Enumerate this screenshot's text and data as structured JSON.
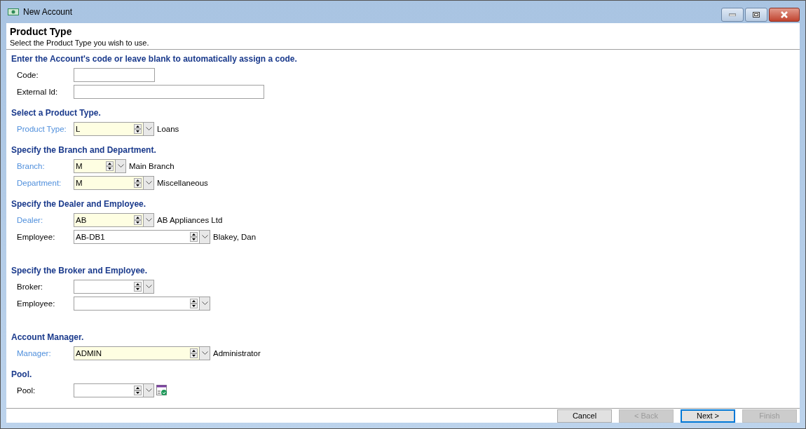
{
  "window": {
    "title": "New Account"
  },
  "header": {
    "title": "Product Type",
    "subtitle": "Select the Product Type you wish to use."
  },
  "sections": [
    {
      "heading": "Enter the Account's code or leave blank to automatically assign a code.",
      "fields": [
        {
          "label": "Code:",
          "kind": "short",
          "required": false
        },
        {
          "label": "External Id:",
          "kind": "long",
          "required": false
        }
      ]
    },
    {
      "heading": "Select a Product Type.",
      "fields": [
        {
          "label": "Product Type:",
          "kind": "combo",
          "required": true,
          "value": "L",
          "description": "Loans"
        }
      ]
    },
    {
      "heading": "Specify the Branch and Department.",
      "fields": [
        {
          "label": "Branch:",
          "kind": "combo-narrow",
          "required": true,
          "value": "M",
          "description": "Main Branch"
        },
        {
          "label": "Department:",
          "kind": "combo",
          "required": true,
          "value": "M",
          "description": "Miscellaneous"
        }
      ]
    },
    {
      "heading": "Specify the Dealer and Employee.",
      "fields": [
        {
          "label": "Dealer:",
          "kind": "combo",
          "required": true,
          "value": "AB",
          "description": "AB Appliances Ltd"
        },
        {
          "label": "Employee:",
          "kind": "combo-wide",
          "required": false,
          "value": "AB-DB1",
          "description": "Blakey, Dan"
        }
      ]
    },
    {
      "heading": "Specify the Broker and Employee.",
      "fields": [
        {
          "label": "Broker:",
          "kind": "combo",
          "required": false
        },
        {
          "label": "Employee:",
          "kind": "combo-wide",
          "required": false
        }
      ]
    },
    {
      "heading": "Account Manager.",
      "fields": [
        {
          "label": "Manager:",
          "kind": "combo-wide",
          "required": true,
          "value": "ADMIN",
          "description": "Administrator"
        }
      ]
    },
    {
      "heading": "Pool.",
      "fields": [
        {
          "label": "Pool:",
          "kind": "combo",
          "required": false,
          "lookup_icon": true
        }
      ]
    }
  ],
  "buttons": [
    {
      "label": "Cancel",
      "disabled": false,
      "default": false
    },
    {
      "label": "< Back",
      "disabled": true,
      "default": false
    },
    {
      "label": "Next >",
      "disabled": false,
      "default": true
    },
    {
      "label": "Finish",
      "disabled": true,
      "default": false
    }
  ]
}
